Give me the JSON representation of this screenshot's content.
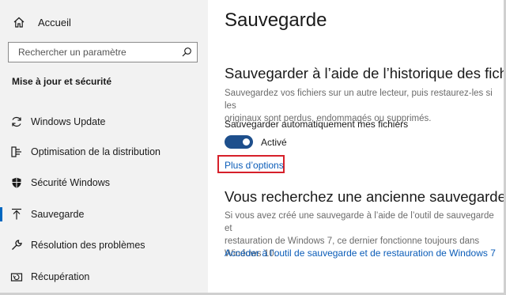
{
  "sidebar": {
    "home_label": "Accueil",
    "search_placeholder": "Rechercher un paramètre",
    "section_title": "Mise à jour et sécurité",
    "items": [
      {
        "label": "Windows Update",
        "icon": "refresh-icon"
      },
      {
        "label": "Optimisation de la distribution",
        "icon": "delivery-optimization-icon"
      },
      {
        "label": "Sécurité Windows",
        "icon": "shield-icon"
      },
      {
        "label": "Sauvegarde",
        "icon": "backup-arrow-icon",
        "active": true
      },
      {
        "label": "Résolution des problèmes",
        "icon": "wrench-icon"
      },
      {
        "label": "Récupération",
        "icon": "recovery-icon"
      }
    ]
  },
  "main": {
    "title": "Sauvegarde",
    "history_heading": "Sauvegarder à l’aide de l’historique des fichiers",
    "history_desc_line1": "Sauvegardez vos fichiers sur un autre lecteur, puis restaurez-les si les",
    "history_desc_line2": "originaux sont perdus, endommagés ou supprimés.",
    "auto_backup_label": "Sauvegarder automatiquement mes fichiers",
    "toggle_state": "Activé",
    "more_options": "Plus d’options",
    "old_backup_heading": "Vous recherchez une ancienne sauvegarde ?",
    "old_backup_line1": "Si vous avez créé une sauvegarde à l’aide de l’outil de sauvegarde et",
    "old_backup_line2": "restauration de Windows 7, ce dernier fonctionne toujours dans",
    "old_backup_line3": "Windows 10.",
    "old_backup_link": "Accéder à l’outil de sauvegarde et de restauration de Windows 7"
  },
  "colors": {
    "accent": "#0067c0",
    "toggle_on": "#1e4f8c",
    "link": "#0a5cb8",
    "highlight_box": "#d6202a",
    "sidebar_bg": "#f2f2f2"
  }
}
